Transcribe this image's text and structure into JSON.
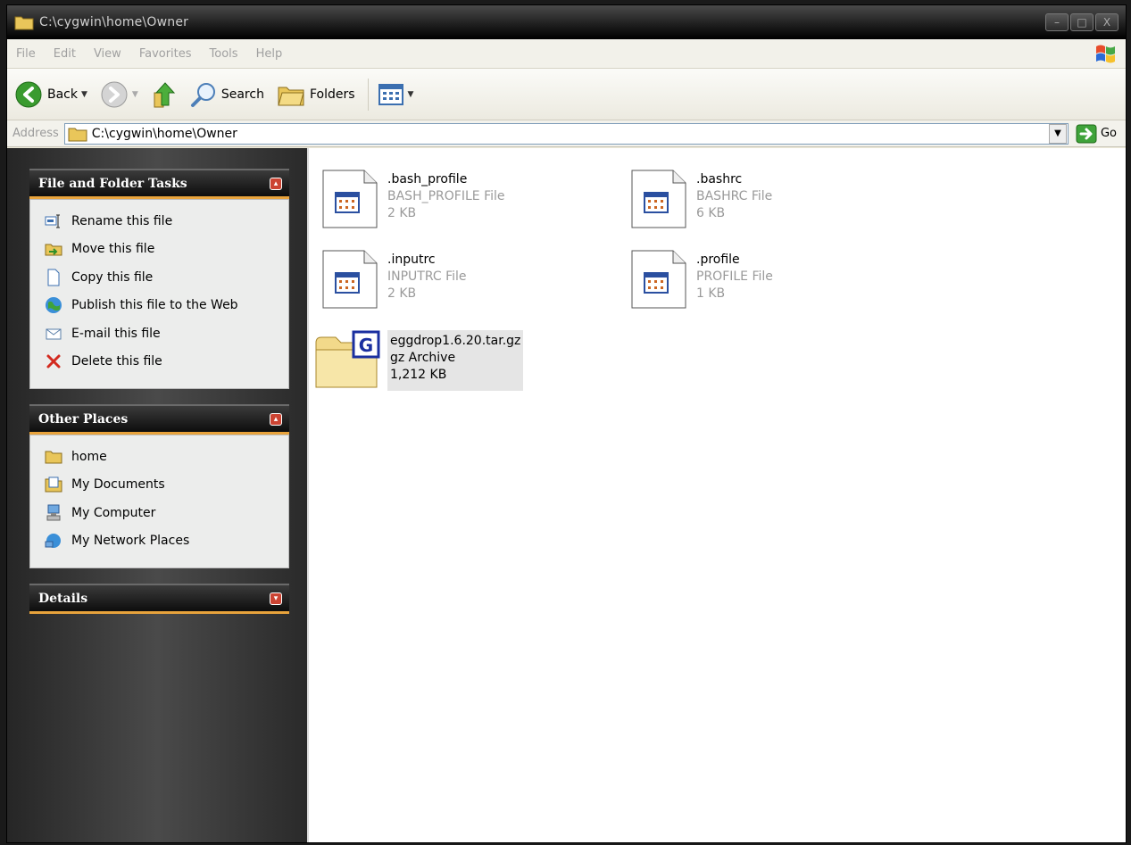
{
  "window": {
    "title": "C:\\cygwin\\home\\Owner",
    "controls": {
      "minimize": "–",
      "maximize": "□",
      "close": "X"
    }
  },
  "menu": {
    "items": [
      "File",
      "Edit",
      "View",
      "Favorites",
      "Tools",
      "Help"
    ]
  },
  "toolbar": {
    "back_label": "Back",
    "search_label": "Search",
    "folders_label": "Folders"
  },
  "address": {
    "label": "Address",
    "value": "C:\\cygwin\\home\\Owner",
    "go_label": "Go"
  },
  "panels": {
    "file_tasks": {
      "title": "File and Folder Tasks",
      "items": [
        {
          "label": "Rename this file",
          "icon": "rename-icon"
        },
        {
          "label": "Move this file",
          "icon": "move-icon"
        },
        {
          "label": "Copy this file",
          "icon": "copy-icon"
        },
        {
          "label": "Publish this file to the Web",
          "icon": "globe-icon"
        },
        {
          "label": "E-mail this file",
          "icon": "email-icon"
        },
        {
          "label": "Delete this file",
          "icon": "delete-icon"
        }
      ]
    },
    "other_places": {
      "title": "Other Places",
      "items": [
        {
          "label": "home",
          "icon": "folder-icon"
        },
        {
          "label": "My Documents",
          "icon": "documents-icon"
        },
        {
          "label": "My Computer",
          "icon": "computer-icon"
        },
        {
          "label": "My Network Places",
          "icon": "network-icon"
        }
      ]
    },
    "details": {
      "title": "Details"
    }
  },
  "files": [
    {
      "name": ".bash_profile",
      "type": "BASH_PROFILE File",
      "size": "2 KB",
      "icon": "text-file-icon"
    },
    {
      "name": ".bashrc",
      "type": "BASHRC File",
      "size": "6 KB",
      "icon": "text-file-icon"
    },
    {
      "name": ".inputrc",
      "type": "INPUTRC File",
      "size": "2 KB",
      "icon": "text-file-icon"
    },
    {
      "name": ".profile",
      "type": "PROFILE File",
      "size": "1 KB",
      "icon": "text-file-icon"
    },
    {
      "name": "eggdrop1.6.20.tar.gz",
      "type": "gz Archive",
      "size": "1,212 KB",
      "icon": "archive-icon",
      "selected": true
    }
  ],
  "colors": {
    "accent": "#e8a33c",
    "panel_bg": "#ecedec",
    "dark": "#1a1a1a"
  }
}
